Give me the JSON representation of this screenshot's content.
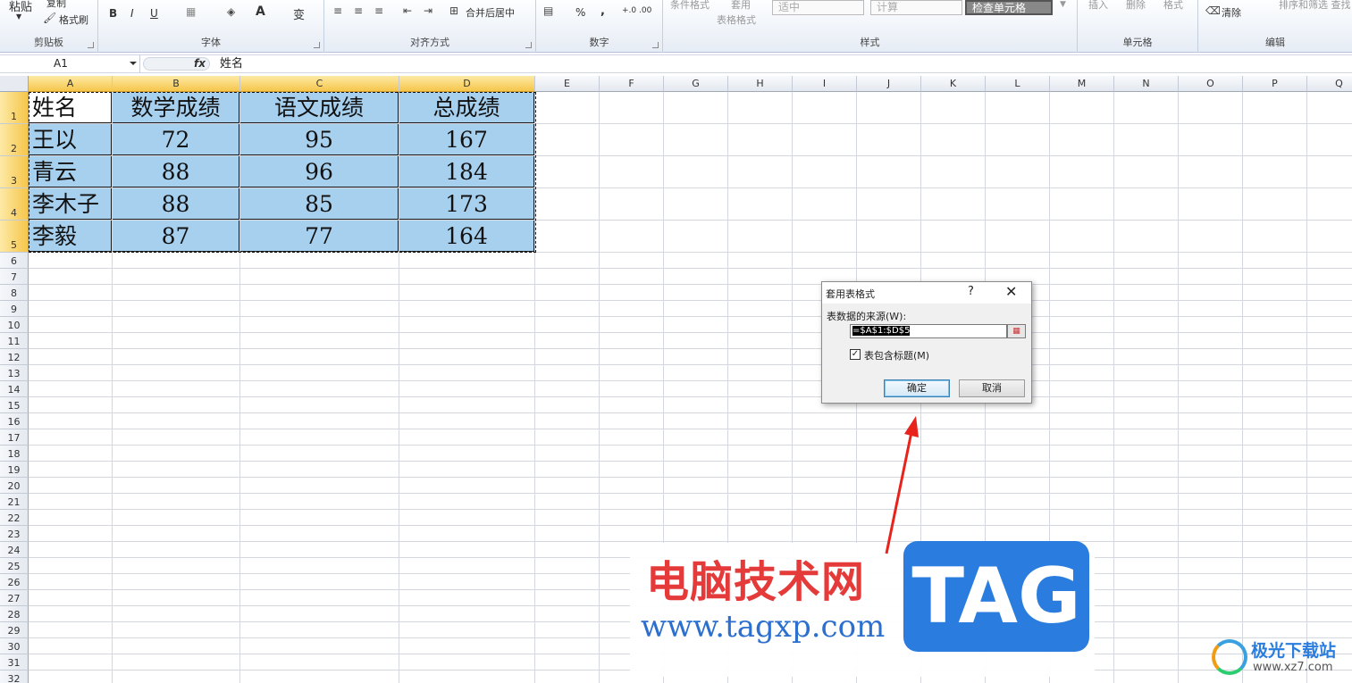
{
  "ribbon": {
    "clipboard": {
      "label": "剪贴板",
      "paste": "粘贴",
      "copy": "复制",
      "format_painter": "格式刷"
    },
    "font": {
      "label": "字体",
      "bold": "B",
      "italic": "I",
      "underline": "U",
      "font_color": "A",
      "phonetic": "变"
    },
    "alignment": {
      "label": "对齐方式",
      "merge_center": "合并后居中"
    },
    "number": {
      "label": "数字",
      "percent": "%",
      "comma": ",",
      "inc_decimal": "+.0 .00",
      "dec_decimal": ".00 +.0"
    },
    "styles": {
      "label": "样式",
      "conditional": "条件格式",
      "table_format_1": "套用",
      "table_format_2": "表格格式",
      "style_neutral": "适中",
      "style_calc": "计算",
      "style_check": "检查单元格"
    },
    "cells": {
      "label": "单元格",
      "insert": "插入",
      "delete": "删除",
      "format": "格式"
    },
    "editing": {
      "label": "编辑",
      "clear": "清除",
      "sort_filter": "排序和筛选 查找"
    }
  },
  "formula_bar": {
    "name_box": "A1",
    "fx": "fx",
    "content": "姓名"
  },
  "sheet": {
    "columns": [
      "A",
      "B",
      "C",
      "D",
      "E",
      "F",
      "G",
      "H",
      "I",
      "J",
      "K",
      "L",
      "M",
      "N",
      "O",
      "P",
      "Q"
    ],
    "rows": [
      "1",
      "2",
      "3",
      "4",
      "5",
      "6",
      "7",
      "8",
      "9",
      "10",
      "11",
      "12",
      "13",
      "14",
      "15",
      "16",
      "17",
      "18",
      "19",
      "20",
      "21",
      "22",
      "23",
      "24",
      "25",
      "26",
      "27",
      "28",
      "29",
      "30",
      "31",
      "32"
    ],
    "table": [
      [
        "姓名",
        "数学成绩",
        "语文成绩",
        "总成绩"
      ],
      [
        "王以",
        "72",
        "95",
        "167"
      ],
      [
        "青云",
        "88",
        "96",
        "184"
      ],
      [
        "李木子",
        "88",
        "85",
        "173"
      ],
      [
        "李毅",
        "87",
        "77",
        "164"
      ]
    ]
  },
  "dialog": {
    "title": "套用表格式",
    "help": "?",
    "close": "✕",
    "source_label": "表数据的来源(W):",
    "range_value": "=$A$1:$D$5",
    "has_headers": "表包含标题(M)",
    "has_headers_checked": true,
    "check_mark": "✓",
    "ok": "确定",
    "cancel": "取消"
  },
  "watermark": {
    "cn": "电脑技术网",
    "url": "www.tagxp.com",
    "tag": "TAG",
    "site2_name": "极光下载站",
    "site2_url": "www.xz7.com"
  },
  "colors": {
    "accent_selection": "#a7d0ef",
    "header_highlight": "#f6c64a",
    "arrow": "#e8231b"
  }
}
